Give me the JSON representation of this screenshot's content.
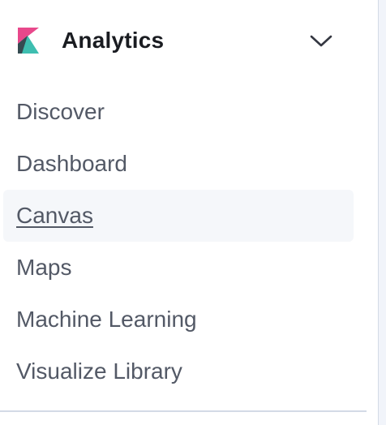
{
  "header": {
    "title": "Analytics",
    "logo_icon": "kibana-logo-icon",
    "toggle_icon": "chevron-down-icon"
  },
  "nav": {
    "items": [
      {
        "label": "Discover",
        "active": false
      },
      {
        "label": "Dashboard",
        "active": false
      },
      {
        "label": "Canvas",
        "active": true
      },
      {
        "label": "Maps",
        "active": false
      },
      {
        "label": "Machine Learning",
        "active": false
      },
      {
        "label": "Visualize Library",
        "active": false
      }
    ]
  },
  "colors": {
    "logo_pink": "#e8488b",
    "logo_teal": "#3ebeb0",
    "logo_dark": "#343741",
    "active_bg": "#f5f7fa",
    "text": "#535966",
    "title": "#1a1c21"
  }
}
